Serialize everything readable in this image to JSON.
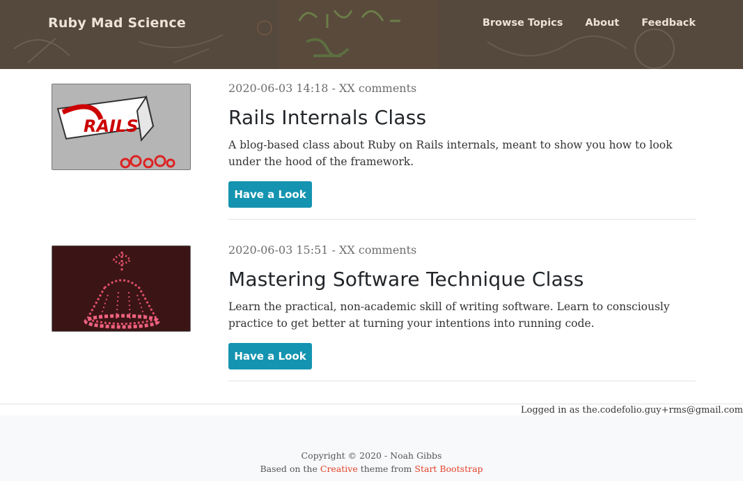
{
  "navbar": {
    "brand": "Ruby Mad Science",
    "links": [
      "Browse Topics",
      "About",
      "Feedback"
    ]
  },
  "posts": [
    {
      "meta": "2020-06-03 14:18 - XX comments",
      "title": "Rails Internals Class",
      "description": "A blog-based class about Ruby on Rails internals, meant to show you how to look under the hood of the framework.",
      "button": "Have a Look",
      "image_logo_text": "RAILS"
    },
    {
      "meta": "2020-06-03 15:51 - XX comments",
      "title": "Mastering Software Technique Class",
      "description": "Learn the practical, non-academic skill of writing software. Learn to consciously practice to get better at turning your intentions into running code.",
      "button": "Have a Look"
    }
  ],
  "login_note": "Logged in as the.codefolio.guy+rms@gmail.com",
  "footer": {
    "copyright": "Copyright © 2020 - Noah Gibbs",
    "based_prefix": "Based on the",
    "based_link1": "Creative",
    "based_middle": "theme from",
    "based_link2": "Start Bootstrap"
  },
  "colors": {
    "header_bg": "#55483d",
    "button_bg": "#1494b0",
    "link_accent": "#e2412a"
  }
}
